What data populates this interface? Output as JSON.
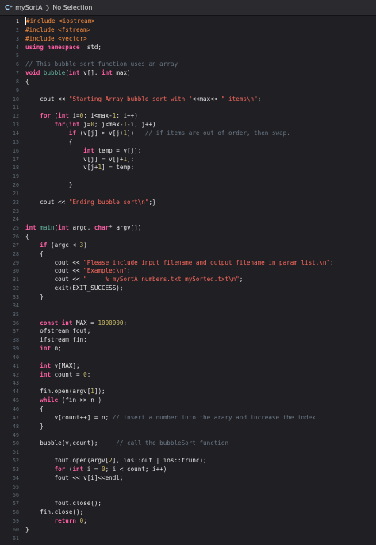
{
  "jumpbar": {
    "file_icon": "C⁺",
    "file_name": "mySortA",
    "separator": "❯",
    "selection": "No Selection"
  },
  "colors": {
    "background": "#1f1f24",
    "keyword": "#fc5fa3",
    "preprocessor": "#fd8f3f",
    "string": "#fc6a5d",
    "number": "#d0bf69",
    "comment": "#6c7986",
    "function": "#67b7a4"
  },
  "lines": [
    {
      "n": "1",
      "t": [
        [
          "pp",
          "#include <iostream>"
        ]
      ]
    },
    {
      "n": "2",
      "t": [
        [
          "pp",
          "#include <fstream>"
        ]
      ]
    },
    {
      "n": "3",
      "t": [
        [
          "pp",
          "#include <vector>"
        ]
      ]
    },
    {
      "n": "4",
      "t": [
        [
          "kw",
          "using namespace"
        ],
        [
          "",
          "  std;"
        ]
      ]
    },
    {
      "n": "5",
      "t": []
    },
    {
      "n": "6",
      "t": [
        [
          "cm",
          "// This bubble sort function uses an array"
        ]
      ]
    },
    {
      "n": "7",
      "t": [
        [
          "kw",
          "void"
        ],
        [
          "",
          " "
        ],
        [
          "fn",
          "bubble"
        ],
        [
          "",
          "("
        ],
        [
          "kw",
          "int"
        ],
        [
          "",
          " v[], "
        ],
        [
          "kw",
          "int"
        ],
        [
          "",
          " max)"
        ]
      ]
    },
    {
      "n": "8",
      "t": [
        [
          "",
          "{"
        ]
      ]
    },
    {
      "n": "9",
      "t": []
    },
    {
      "n": "10",
      "t": [
        [
          "",
          "    cout << "
        ],
        [
          "str",
          "\"Starting Array bubble sort with \""
        ],
        [
          "",
          "<<max<< "
        ],
        [
          "str",
          "\" items\\n\""
        ],
        [
          "",
          ";"
        ]
      ]
    },
    {
      "n": "11",
      "t": []
    },
    {
      "n": "12",
      "t": [
        [
          "",
          "    "
        ],
        [
          "kw",
          "for"
        ],
        [
          "",
          " ("
        ],
        [
          "kw",
          "int"
        ],
        [
          "",
          " i="
        ],
        [
          "num",
          "0"
        ],
        [
          "",
          "; i<max-"
        ],
        [
          "num",
          "1"
        ],
        [
          "",
          "; i++)"
        ]
      ]
    },
    {
      "n": "13",
      "t": [
        [
          "",
          "        "
        ],
        [
          "kw",
          "for"
        ],
        [
          "",
          "("
        ],
        [
          "kw",
          "int"
        ],
        [
          "",
          " j="
        ],
        [
          "num",
          "0"
        ],
        [
          "",
          "; j<max-"
        ],
        [
          "num",
          "1"
        ],
        [
          "",
          "-i; j++)"
        ]
      ]
    },
    {
      "n": "14",
      "t": [
        [
          "",
          "            "
        ],
        [
          "kw",
          "if"
        ],
        [
          "",
          " (v[j] > v[j+"
        ],
        [
          "num",
          "1"
        ],
        [
          "",
          "])   "
        ],
        [
          "cm",
          "// if items are out of order, then swap."
        ]
      ]
    },
    {
      "n": "15",
      "t": [
        [
          "",
          "            {"
        ]
      ]
    },
    {
      "n": "16",
      "t": [
        [
          "",
          "                "
        ],
        [
          "kw",
          "int"
        ],
        [
          "",
          " temp = v[j];"
        ]
      ]
    },
    {
      "n": "17",
      "t": [
        [
          "",
          "                v[j] = v[j+"
        ],
        [
          "num",
          "1"
        ],
        [
          "",
          "];"
        ]
      ]
    },
    {
      "n": "18",
      "t": [
        [
          "",
          "                v[j+"
        ],
        [
          "num",
          "1"
        ],
        [
          "",
          "] = temp;"
        ]
      ]
    },
    {
      "n": "19",
      "t": []
    },
    {
      "n": "20",
      "t": [
        [
          "",
          "            }"
        ]
      ]
    },
    {
      "n": "21",
      "t": []
    },
    {
      "n": "22",
      "t": [
        [
          "",
          "    cout << "
        ],
        [
          "str",
          "\"Ending bubble sort\\n\""
        ],
        [
          "",
          ";}"
        ]
      ]
    },
    {
      "n": "23",
      "t": []
    },
    {
      "n": "24",
      "t": []
    },
    {
      "n": "25",
      "t": [
        [
          "kw",
          "int"
        ],
        [
          "",
          " "
        ],
        [
          "fn",
          "main"
        ],
        [
          "",
          "("
        ],
        [
          "kw",
          "int"
        ],
        [
          "",
          " argc, "
        ],
        [
          "kw",
          "char"
        ],
        [
          "",
          "* argv[])"
        ]
      ]
    },
    {
      "n": "26",
      "t": [
        [
          "",
          "{"
        ]
      ]
    },
    {
      "n": "27",
      "t": [
        [
          "",
          "    "
        ],
        [
          "kw",
          "if"
        ],
        [
          "",
          " (argc < "
        ],
        [
          "num",
          "3"
        ],
        [
          "",
          ")"
        ]
      ]
    },
    {
      "n": "28",
      "t": [
        [
          "",
          "    {"
        ]
      ]
    },
    {
      "n": "29",
      "t": [
        [
          "",
          "        cout << "
        ],
        [
          "str",
          "\"Please include input filename and output filename in param list.\\n\""
        ],
        [
          "",
          ";"
        ]
      ]
    },
    {
      "n": "30",
      "t": [
        [
          "",
          "        cout << "
        ],
        [
          "str",
          "\"Example:\\n\""
        ],
        [
          "",
          ";"
        ]
      ]
    },
    {
      "n": "31",
      "t": [
        [
          "",
          "        cout << "
        ],
        [
          "str",
          "\"     % mySortA numbers.txt mySorted.txt\\n\""
        ],
        [
          "",
          ";"
        ]
      ]
    },
    {
      "n": "32",
      "t": [
        [
          "",
          "        exit(EXIT_SUCCESS);"
        ]
      ]
    },
    {
      "n": "33",
      "t": [
        [
          "",
          "    }"
        ]
      ]
    },
    {
      "n": "34",
      "t": []
    },
    {
      "n": "35",
      "t": []
    },
    {
      "n": "36",
      "t": [
        [
          "",
          "    "
        ],
        [
          "kw",
          "const int"
        ],
        [
          "",
          " MAX = "
        ],
        [
          "num",
          "1000000"
        ],
        [
          "",
          ";"
        ]
      ]
    },
    {
      "n": "37",
      "t": [
        [
          "",
          "    ofstream fout;"
        ]
      ]
    },
    {
      "n": "38",
      "t": [
        [
          "",
          "    ifstream fin;"
        ]
      ]
    },
    {
      "n": "39",
      "t": [
        [
          "",
          "    "
        ],
        [
          "kw",
          "int"
        ],
        [
          "",
          " n;"
        ]
      ]
    },
    {
      "n": "40",
      "t": []
    },
    {
      "n": "41",
      "t": [
        [
          "",
          "    "
        ],
        [
          "kw",
          "int"
        ],
        [
          "",
          " v[MAX];"
        ]
      ]
    },
    {
      "n": "42",
      "t": [
        [
          "",
          "    "
        ],
        [
          "kw",
          "int"
        ],
        [
          "",
          " count = "
        ],
        [
          "num",
          "0"
        ],
        [
          "",
          ";"
        ]
      ]
    },
    {
      "n": "43",
      "t": []
    },
    {
      "n": "44",
      "t": [
        [
          "",
          "    fin.open(argv["
        ],
        [
          "num",
          "1"
        ],
        [
          "",
          "]);"
        ]
      ]
    },
    {
      "n": "45",
      "t": [
        [
          "",
          "    "
        ],
        [
          "kw",
          "while"
        ],
        [
          "",
          " (fin >> n )"
        ]
      ]
    },
    {
      "n": "46",
      "t": [
        [
          "",
          "    {"
        ]
      ]
    },
    {
      "n": "47",
      "t": [
        [
          "",
          "        v[count++] = n; "
        ],
        [
          "cm",
          "// insert a number into the arary and increase the index"
        ]
      ]
    },
    {
      "n": "48",
      "t": [
        [
          "",
          "    }"
        ]
      ]
    },
    {
      "n": "49",
      "t": []
    },
    {
      "n": "50",
      "t": [
        [
          "",
          "    bubble(v,count);     "
        ],
        [
          "cm",
          "// call the bubbleSort function"
        ]
      ]
    },
    {
      "n": "51",
      "t": []
    },
    {
      "n": "52",
      "t": [
        [
          "",
          "        fout.open(argv["
        ],
        [
          "num",
          "2"
        ],
        [
          "",
          "], ios::out | ios::trunc);"
        ]
      ]
    },
    {
      "n": "53",
      "t": [
        [
          "",
          "        "
        ],
        [
          "kw",
          "for"
        ],
        [
          "",
          " ("
        ],
        [
          "kw",
          "int"
        ],
        [
          "",
          " i = "
        ],
        [
          "num",
          "0"
        ],
        [
          "",
          "; i < count; i++)"
        ]
      ]
    },
    {
      "n": "54",
      "t": [
        [
          "",
          "        fout << v[i]<<endl;"
        ]
      ]
    },
    {
      "n": "55",
      "t": []
    },
    {
      "n": "56",
      "t": []
    },
    {
      "n": "57",
      "t": [
        [
          "",
          "        fout.close();"
        ]
      ]
    },
    {
      "n": "58",
      "t": [
        [
          "",
          "    fin.close();"
        ]
      ]
    },
    {
      "n": "59",
      "t": [
        [
          "",
          "        "
        ],
        [
          "kw",
          "return"
        ],
        [
          "",
          " "
        ],
        [
          "num",
          "0"
        ],
        [
          "",
          ";"
        ]
      ]
    },
    {
      "n": "60",
      "t": [
        [
          "",
          "}"
        ]
      ]
    },
    {
      "n": "61",
      "t": []
    }
  ]
}
